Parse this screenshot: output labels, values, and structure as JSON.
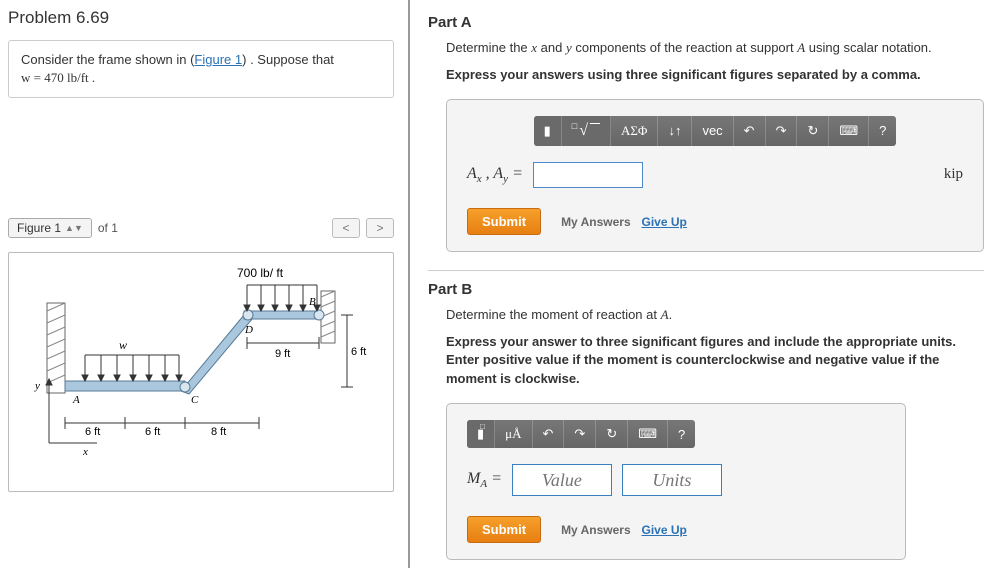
{
  "problem": {
    "title": "Problem 6.69",
    "intro_prefix": "Consider the frame shown in (",
    "figure_link": "Figure 1",
    "intro_suffix": ") . Suppose that",
    "w_eq": "w = 470 lb/ft ."
  },
  "figbar": {
    "figure_btn": "Figure 1",
    "of_txt": "of 1",
    "prev": "<",
    "next": ">"
  },
  "figure_labels": {
    "load_top": "700 lb/ ft",
    "w": "w",
    "pt_A": "A",
    "pt_B": "B",
    "pt_C": "C",
    "pt_D": "D",
    "x": "x",
    "y": "y",
    "d6a": "6 ft",
    "d6b": "6 ft",
    "d8": "8 ft",
    "d9": "9 ft",
    "d6v": "6 ft"
  },
  "partA": {
    "title": "Part A",
    "desc": "Determine the x and y components of the reaction at support A using scalar notation.",
    "hint": "Express your answers using three significant figures separated by a comma.",
    "toolbar": {
      "tb1": "▮",
      "tb2_root": "√",
      "tb2_box": "□",
      "tb3": "ΑΣΦ",
      "tb4": "↓↑",
      "tb5": "vec",
      "undo": "↶",
      "redo": "↷",
      "reset": "↻",
      "kbd": "⌨",
      "help": "?"
    },
    "eq_label": "A_x , A_y =",
    "unit": "kip",
    "submit": "Submit",
    "my_answers": "My Answers",
    "giveup": "Give Up"
  },
  "partB": {
    "title": "Part B",
    "desc": "Determine the moment of reaction at A.",
    "hint": "Express your answer to three significant figures and include the appropriate units. Enter positive value if the moment is counterclockwise and negative value if the moment is clockwise.",
    "toolbar": {
      "tb1": "▮",
      "tb2": "μÅ",
      "undo": "↶",
      "redo": "↷",
      "reset": "↻",
      "kbd": "⌨",
      "help": "?"
    },
    "eq_label": "M_A =",
    "value_ph": "Value",
    "units_ph": "Units",
    "submit": "Submit",
    "my_answers": "My Answers",
    "giveup": "Give Up"
  }
}
